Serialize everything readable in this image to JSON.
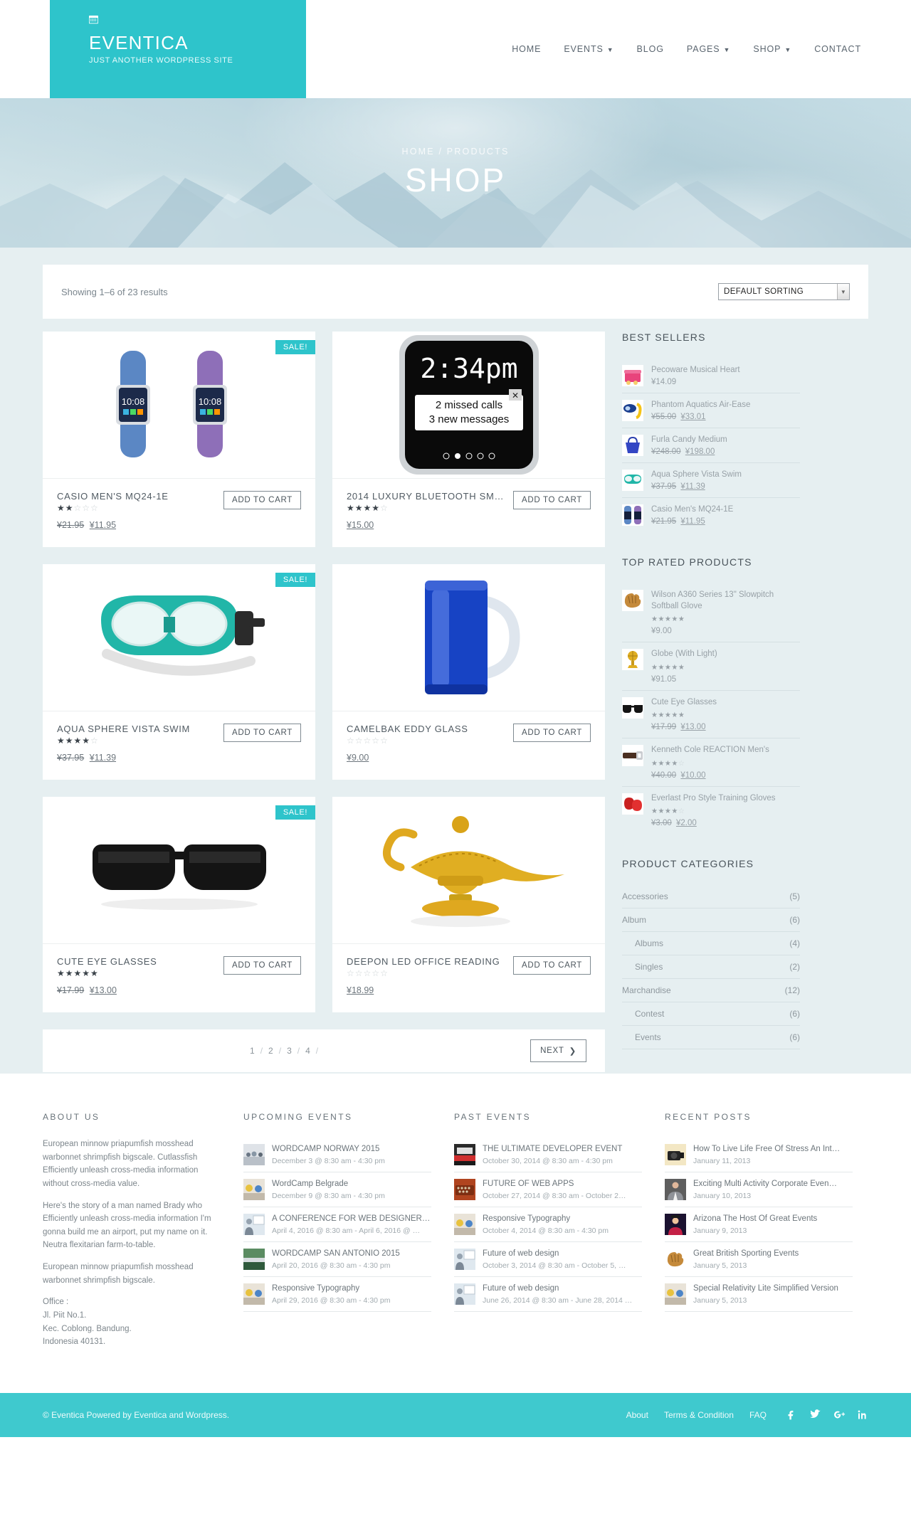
{
  "header": {
    "brand_name": "EVENTICA",
    "brand_tagline": "JUST ANOTHER WORDPRESS SITE",
    "calendar_icon": "calendar-icon",
    "nav": [
      {
        "label": "HOME",
        "has_caret": false
      },
      {
        "label": "EVENTS",
        "has_caret": true
      },
      {
        "label": "BLOG",
        "has_caret": false
      },
      {
        "label": "PAGES",
        "has_caret": true
      },
      {
        "label": "SHOP",
        "has_caret": true
      },
      {
        "label": "CONTACT",
        "has_caret": false
      }
    ]
  },
  "hero": {
    "breadcrumb": "HOME / PRODUCTS",
    "title": "SHOP"
  },
  "toolbar": {
    "showing": "Showing 1–6 of 23 results",
    "sorting_value": "DEFAULT SORTING",
    "sorting_arrow": "chevron-down-icon"
  },
  "products": [
    {
      "title": "CASIO MEN'S MQ24-1E",
      "stars_on": 2,
      "stars_total": 5,
      "old_price": "¥21.95",
      "price": "¥11.95",
      "on_sale": true,
      "sale_label": "SALE!",
      "add_to_cart": "ADD TO CART",
      "image": "smartwatch-pair-image"
    },
    {
      "title": "2014 LUXURY BLUETOOTH SM…",
      "stars_on": 4,
      "stars_total": 5,
      "old_price": "",
      "price": "¥15.00",
      "on_sale": false,
      "sale_label": "",
      "add_to_cart": "ADD TO CART",
      "image": "black-smartwatch-image"
    },
    {
      "title": "AQUA SPHERE VISTA SWIM",
      "stars_on": 4,
      "stars_total": 5,
      "old_price": "¥37.95",
      "price": "¥11.39",
      "on_sale": true,
      "sale_label": "SALE!",
      "add_to_cart": "ADD TO CART",
      "image": "swim-mask-image"
    },
    {
      "title": "CAMELBAK EDDY GLASS",
      "stars_on": 0,
      "stars_total": 5,
      "old_price": "",
      "price": "¥9.00",
      "on_sale": false,
      "sale_label": "",
      "add_to_cart": "ADD TO CART",
      "image": "blue-glass-mug-image"
    },
    {
      "title": "CUTE EYE GLASSES",
      "stars_on": 5,
      "stars_total": 5,
      "old_price": "¥17.99",
      "price": "¥13.00",
      "on_sale": true,
      "sale_label": "SALE!",
      "add_to_cart": "ADD TO CART",
      "image": "eyeglasses-image"
    },
    {
      "title": "DEEPON LED OFFICE READING",
      "stars_on": 0,
      "stars_total": 5,
      "old_price": "",
      "price": "¥18.99",
      "on_sale": false,
      "sale_label": "",
      "add_to_cart": "ADD TO CART",
      "image": "golden-oil-lamp-image"
    }
  ],
  "pagination": {
    "pages": [
      "1",
      "2",
      "3",
      "4"
    ],
    "next_label": "NEXT",
    "next_icon": "chevron-right-icon"
  },
  "sidebar": {
    "best_sellers": {
      "title": "BEST SELLERS",
      "items": [
        {
          "name": "Pecoware Musical Heart",
          "old_price": "",
          "price": "¥14.09",
          "image": "pink-music-box-image"
        },
        {
          "name": "Phantom Aquatics Air-Ease",
          "old_price": "¥55.00",
          "price": "¥33.01",
          "image": "snorkel-set-image"
        },
        {
          "name": "Furla Candy Medium",
          "old_price": "¥248.00",
          "price": "¥198.00",
          "image": "blue-handbag-image"
        },
        {
          "name": "Aqua Sphere Vista Swim",
          "old_price": "¥37.95",
          "price": "¥11.39",
          "image": "swim-goggles-image"
        },
        {
          "name": "Casio Men's MQ24-1E",
          "old_price": "¥21.95",
          "price": "¥11.95",
          "image": "smartwatch-pair-image"
        }
      ]
    },
    "top_rated": {
      "title": "TOP RATED PRODUCTS",
      "items": [
        {
          "name": "Wilson A360 Series 13\" Slowpitch Softball Glove",
          "stars_on": 5,
          "old_price": "",
          "price": "¥9.00",
          "image": "baseball-glove-image"
        },
        {
          "name": "Globe (With Light)",
          "stars_on": 5,
          "old_price": "",
          "price": "¥91.05",
          "image": "gold-globe-image"
        },
        {
          "name": "Cute Eye Glasses",
          "stars_on": 5,
          "old_price": "¥17.99",
          "price": "¥13.00",
          "image": "eyeglasses-image"
        },
        {
          "name": "Kenneth Cole REACTION Men's",
          "stars_on": 4,
          "old_price": "¥40.00",
          "price": "¥10.00",
          "image": "leather-belt-image"
        },
        {
          "name": "Everlast Pro Style Training Gloves",
          "stars_on": 4,
          "old_price": "¥3.00",
          "price": "¥2.00",
          "image": "boxing-gloves-image"
        }
      ]
    },
    "categories": {
      "title": "PRODUCT CATEGORIES",
      "items": [
        {
          "label": "Accessories",
          "count": "(5)",
          "child": false
        },
        {
          "label": "Album",
          "count": "(6)",
          "child": false
        },
        {
          "label": "Albums",
          "count": "(4)",
          "child": true
        },
        {
          "label": "Singles",
          "count": "(2)",
          "child": true
        },
        {
          "label": "Marchandise",
          "count": "(12)",
          "child": false
        },
        {
          "label": "Contest",
          "count": "(6)",
          "child": true
        },
        {
          "label": "Events",
          "count": "(6)",
          "child": true
        }
      ]
    }
  },
  "footer": {
    "about": {
      "title": "ABOUT US",
      "paragraphs": [
        "European minnow priapumfish mosshead warbonnet shrimpfish bigscale. Cutlassfish Efficiently unleash cross-media information without cross-media value.",
        "Here's the story of a man named Brady who Efficiently unleash cross-media information I'm gonna build me an airport, put my name on it. Neutra flexitarian farm-to-table.",
        "European minnow priapumfish mosshead warbonnet shrimpfish bigscale."
      ],
      "office_lines": [
        "Office :",
        "Jl. Piit No.1.",
        "Kec. Coblong. Bandung.",
        "Indonesia 40131."
      ]
    },
    "upcoming_events": {
      "title": "UPCOMING EVENTS",
      "items": [
        {
          "name": "WORDCAMP NORWAY 2015",
          "date": "December 3 @ 8:30 am - 4:30 pm",
          "image": "meeting-room-image"
        },
        {
          "name": "WordCamp Belgrade",
          "date": "December 9 @ 8:30 am - 4:30 pm",
          "image": "laptop-team-image"
        },
        {
          "name": "A CONFERENCE FOR WEB DESIGNER…",
          "date": "April 4, 2016 @ 8:30 am - April 6, 2016 @ …",
          "image": "presenter-image"
        },
        {
          "name": "WORDCAMP SAN ANTONIO 2015",
          "date": "April 20, 2016 @ 8:30 am - 4:30 pm",
          "image": "aerial-city-image"
        },
        {
          "name": "Responsive Typography",
          "date": "April 29, 2016 @ 8:30 am - 4:30 pm",
          "image": "laptop-team-image"
        }
      ]
    },
    "past_events": {
      "title": "PAST EVENTS",
      "items": [
        {
          "name": "THE ULTIMATE DEVELOPER EVENT",
          "date": "October 30, 2014 @ 8:30 am - 4:30 pm",
          "image": "red-desk-image"
        },
        {
          "name": "FUTURE OF WEB APPS",
          "date": "October 27, 2014 @ 8:30 am - October 2…",
          "image": "vintage-keyboard-image"
        },
        {
          "name": "Responsive Typography",
          "date": "October 4, 2014 @ 8:30 am - 4:30 pm",
          "image": "laptop-team-image"
        },
        {
          "name": "Future of web design",
          "date": "October 3, 2014 @ 8:30 am - October 5, …",
          "image": "presenter-image"
        },
        {
          "name": "Future of web design",
          "date": "June 26, 2014 @ 8:30 am - June 28, 2014 …",
          "image": "presenter-image"
        }
      ]
    },
    "recent_posts": {
      "title": "RECENT POSTS",
      "items": [
        {
          "name": "How To Live Life Free Of Stress An Int…",
          "date": "January 11, 2013",
          "image": "camera-image"
        },
        {
          "name": "Exciting Multi Activity Corporate Even…",
          "date": "January 10, 2013",
          "image": "man-suit-image"
        },
        {
          "name": "Arizona The Host Of Great Events",
          "date": "January 9, 2013",
          "image": "performer-image"
        },
        {
          "name": "Great British Sporting Events",
          "date": "January 5, 2013",
          "image": "baseball-glove-image"
        },
        {
          "name": "Special Relativity Lite Simplified Version",
          "date": "January 5, 2013",
          "image": "laptop-team-image"
        }
      ]
    }
  },
  "bottom_bar": {
    "copyright": "© Eventica Powered by Eventica and Wordpress.",
    "links": [
      "About",
      "Terms & Condition",
      "FAQ"
    ],
    "socials": [
      "facebook-icon",
      "twitter-icon",
      "google-plus-icon",
      "linkedin-icon"
    ]
  },
  "colors": {
    "accent": "#2ec4cb",
    "accent_bottom": "#3fc9ce",
    "page_bg": "#e6eff1"
  }
}
